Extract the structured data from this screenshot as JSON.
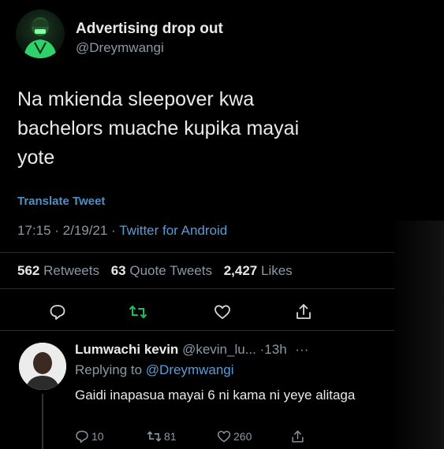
{
  "tweet": {
    "display_name": "Advertising drop out",
    "handle": "@Dreymwangi",
    "text": "Na mkienda sleepover kwa bachelors muache kupika mayai yote",
    "translate_label": "Translate Tweet",
    "time": "17:15",
    "date": "2/19/21",
    "source": "Twitter for Android",
    "stats": {
      "retweets_count": "562",
      "retweets_label": "Retweets",
      "quotes_count": "63",
      "quotes_label": "Quote Tweets",
      "likes_count": "2,427",
      "likes_label": "Likes"
    },
    "actions": [
      "reply-icon",
      "retweet-icon",
      "like-icon",
      "share-icon"
    ],
    "accent_color": "#17bf63"
  },
  "reply": {
    "display_name": "Lumwachi kevin",
    "handle": "@kevin_lu...",
    "age": "13h",
    "more": "···",
    "replying_label": "Replying to",
    "replying_to": "@Dreymwangi",
    "text": "Gaidi inapasua mayai 6 ni kama ni yeye alitaga",
    "reply_count": "10",
    "retweet_count": "81",
    "like_count": "260"
  }
}
